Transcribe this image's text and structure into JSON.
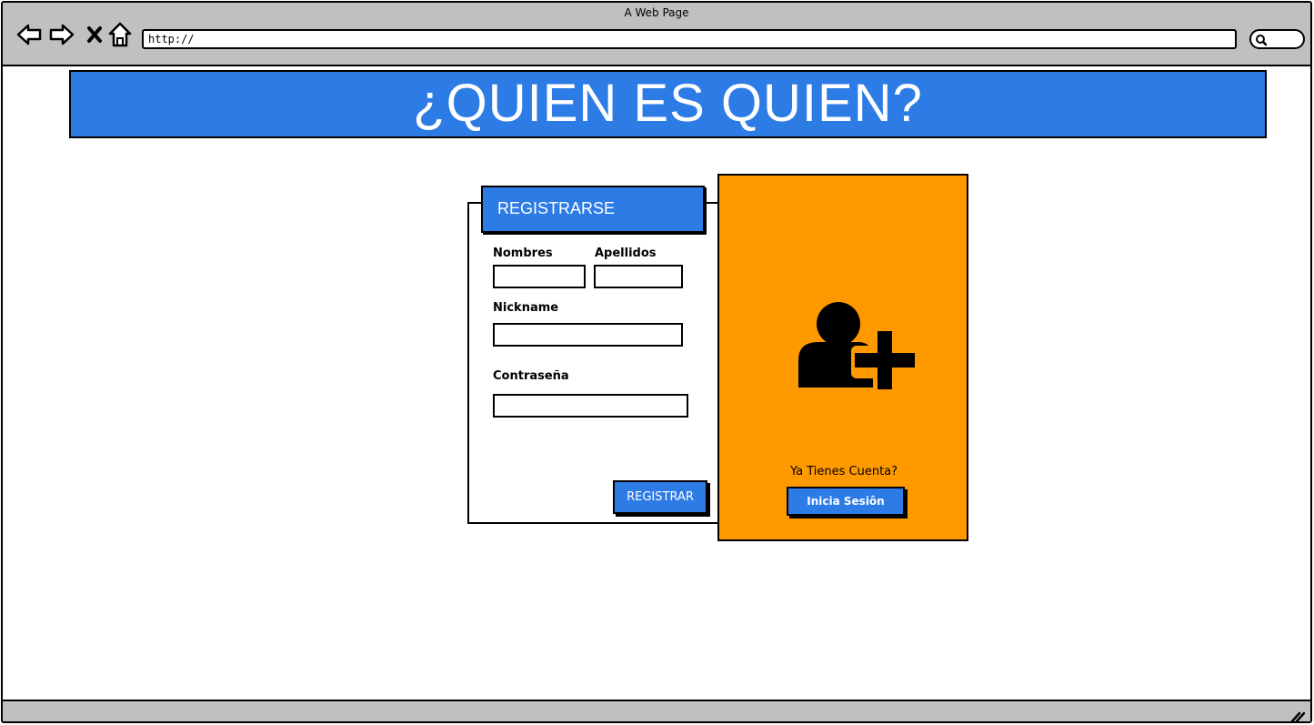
{
  "browser": {
    "window_title": "A Web Page",
    "url": "http://"
  },
  "page": {
    "banner_title": "¿QUIEN ES QUIEN?"
  },
  "register_form": {
    "header": "REGISTRARSE",
    "fields": {
      "nombres_label": "Nombres",
      "apellidos_label": "Apellidos",
      "nickname_label": "Nickname",
      "password_label": "Contraseña"
    },
    "submit_label": "REGISTRAR"
  },
  "login_panel": {
    "prompt": "Ya Tienes Cuenta?",
    "login_label": "Inicia Sesiôn"
  },
  "colors": {
    "accent_blue": "#2d7be5",
    "panel_orange": "#ff9900",
    "chrome_gray": "#c0c0c0"
  },
  "icons": [
    "back-arrow-icon",
    "forward-arrow-icon",
    "close-icon",
    "home-icon",
    "search-icon",
    "user-add-icon",
    "resize-grip-icon"
  ]
}
